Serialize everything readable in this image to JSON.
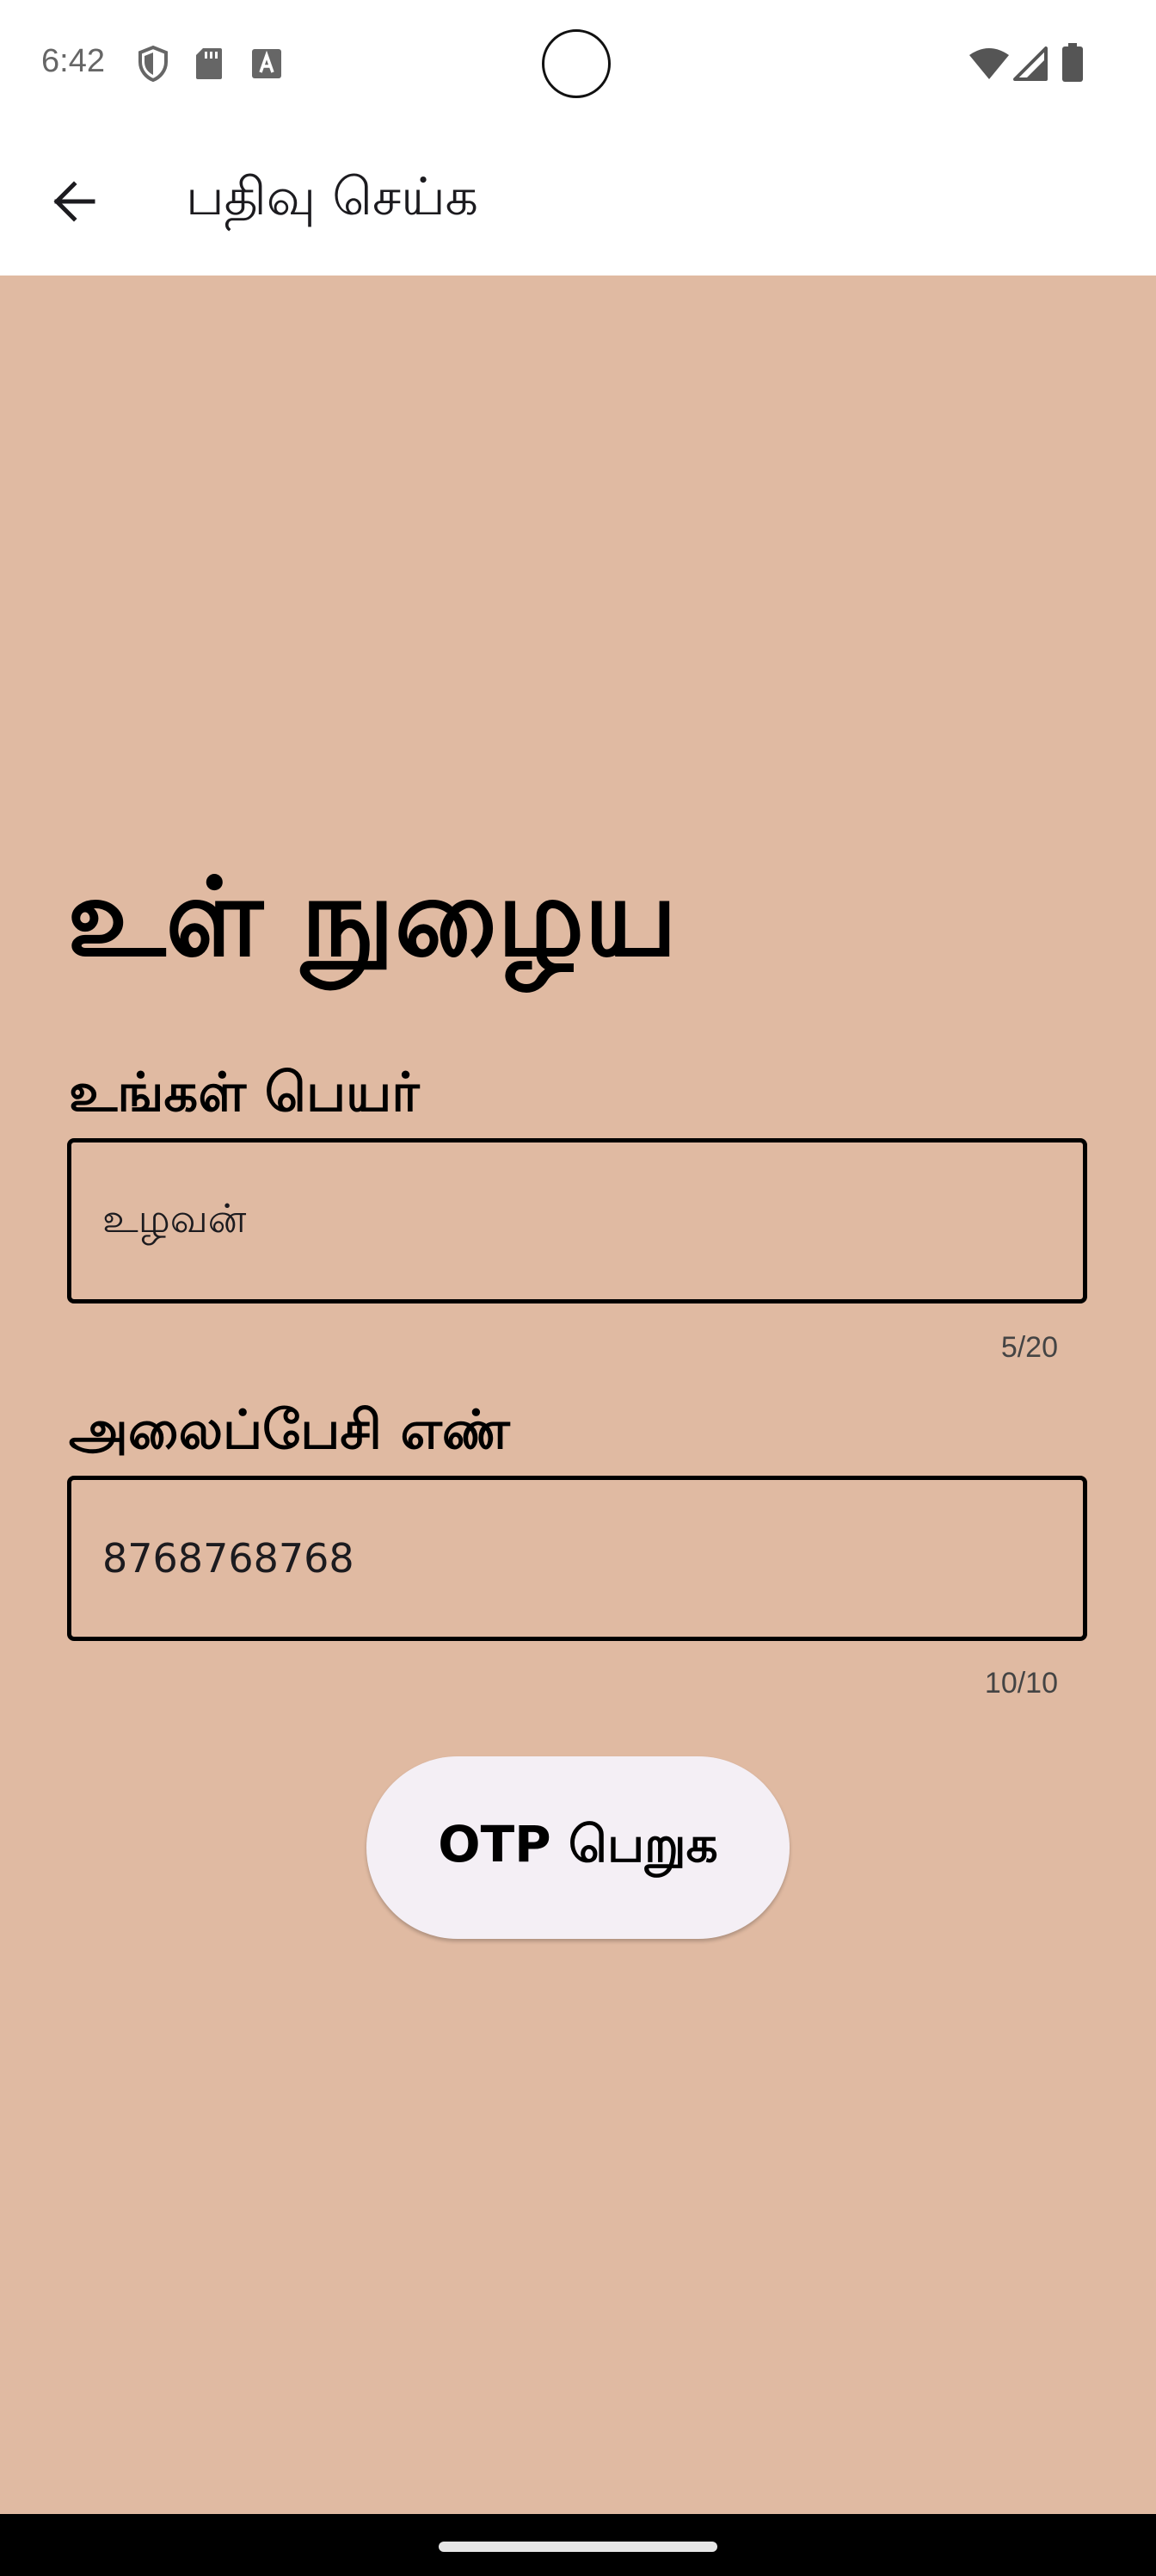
{
  "status_bar": {
    "time": "6:42",
    "left_icons": [
      "shield-icon",
      "sd-card-icon",
      "font-a-icon"
    ],
    "right_icons": [
      "wifi-icon",
      "cell-signal-icon",
      "battery-icon"
    ]
  },
  "app_bar": {
    "back_icon": "arrow-back-icon",
    "title": "பதிவு செய்க"
  },
  "login": {
    "heading": "உள் நுழைய",
    "name_field": {
      "label": "உங்கள் பெயர்",
      "value": "உழவன்",
      "counter": "5/20"
    },
    "phone_field": {
      "label": "அலைப்பேசி எண்",
      "value": "8768768768",
      "counter": "10/10"
    },
    "otp_button_label": "OTP பெறுக"
  },
  "colors": {
    "background": "#e0baa2",
    "button_bg": "#f4eff5",
    "bar_bg": "#ffffff"
  }
}
